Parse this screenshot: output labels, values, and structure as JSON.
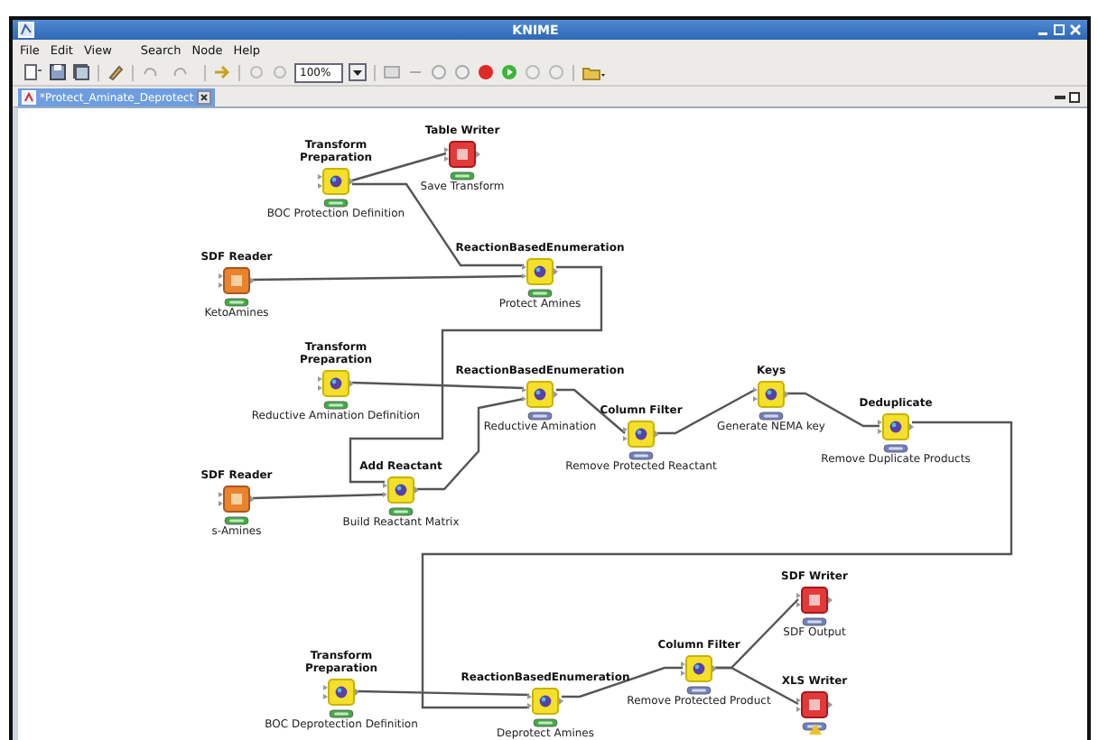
{
  "window": {
    "title": "KNIME"
  },
  "menu": [
    "File",
    "Edit",
    "View",
    "Search",
    "Node",
    "Help"
  ],
  "toolbar": {
    "zoom": "100%"
  },
  "editor_tab": {
    "label": "*Protect_Aminate_Deprotect",
    "selected": true
  },
  "nodes": [
    {
      "title": "Transform Preparation",
      "label": "BOC Protection Definition",
      "kind": "manipulator",
      "executed": true
    },
    {
      "title": "Table Writer",
      "label": "Save Transform",
      "kind": "writer",
      "executed": true
    },
    {
      "title": "SDF Reader",
      "label": "KetoAmines",
      "kind": "reader",
      "executed": true
    },
    {
      "title": "ReactionBasedEnumeration",
      "label": "Protect Amines",
      "kind": "manipulator",
      "executed": true
    },
    {
      "title": "Transform Preparation",
      "label": "Reductive Amination Definition",
      "kind": "manipulator",
      "executed": true
    },
    {
      "title": "ReactionBasedEnumeration",
      "label": "Reductive Amination",
      "kind": "manipulator",
      "executed": false
    },
    {
      "title": "Column Filter",
      "label": "Remove Protected Reactant",
      "kind": "manipulator",
      "executed": false
    },
    {
      "title": "Keys",
      "label": "Generate NEMA key",
      "kind": "manipulator",
      "executed": false
    },
    {
      "title": "Deduplicate",
      "label": "Remove Duplicate Products",
      "kind": "manipulator",
      "executed": false
    },
    {
      "title": "SDF Reader",
      "label": "s-Amines",
      "kind": "reader",
      "executed": true
    },
    {
      "title": "Add Reactant",
      "label": "Build Reactant Matrix",
      "kind": "manipulator",
      "executed": true
    },
    {
      "title": "Transform Preparation",
      "label": "BOC Deprotection Definition",
      "kind": "manipulator",
      "executed": true
    },
    {
      "title": "ReactionBasedEnumeration",
      "label": "Deprotect Amines",
      "kind": "manipulator",
      "executed": true
    },
    {
      "title": "Column Filter",
      "label": "Remove Protected Product",
      "kind": "manipulator",
      "executed": false
    },
    {
      "title": "SDF Writer",
      "label": "SDF Output",
      "kind": "writer",
      "executed": false
    },
    {
      "title": "XLS Writer",
      "kind": "writer",
      "executed": false,
      "warning": true
    }
  ]
}
